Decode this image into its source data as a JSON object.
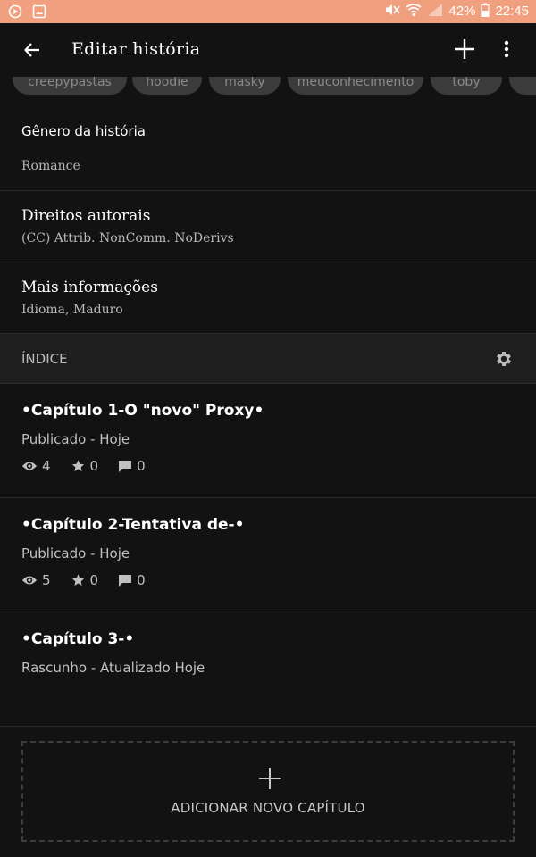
{
  "status_bar": {
    "battery": "42%",
    "time": "22:45"
  },
  "app_bar": {
    "title": "Editar história"
  },
  "tags": [
    "creepypastas",
    "hoodie",
    "masky",
    "meuconhecimento",
    "toby",
    ""
  ],
  "genre": {
    "title": "Gênero da história",
    "value": "Romance"
  },
  "copyright": {
    "title": "Direitos autorais",
    "value": "(CC) Attrib. NonComm. NoDerivs"
  },
  "more_info": {
    "title": "Mais informações",
    "value": "Idioma, Maduro"
  },
  "index": {
    "label": "ÍNDICE"
  },
  "chapters": [
    {
      "title": "•Capítulo 1-O \"novo\" Proxy•",
      "status": "Publicado - Hoje",
      "views": "4",
      "votes": "0",
      "comments": "0"
    },
    {
      "title": "•Capítulo 2-Tentativa de-•",
      "status": "Publicado - Hoje",
      "views": "5",
      "votes": "0",
      "comments": "0"
    },
    {
      "title": "•Capítulo 3-•",
      "status": "Rascunho - Atualizado Hoje"
    }
  ],
  "add_chapter": {
    "label": "ADICIONAR NOVO CAPÍTULO"
  },
  "colors": {
    "status_bar": "#f0a07e",
    "background": "#121212",
    "index_header": "#1e1e1e"
  }
}
